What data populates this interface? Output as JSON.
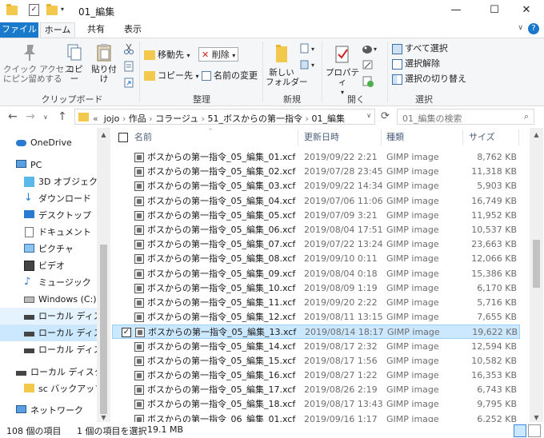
{
  "window": {
    "title": "01_編集",
    "minimize": "—",
    "maximize": "☐",
    "close": "✕"
  },
  "ribbon_tabs": {
    "file": "ファイル",
    "home": "ホーム",
    "share": "共有",
    "view": "表示"
  },
  "ribbon": {
    "clipboard": {
      "pin": "クイック アクセス\nにピン留めする",
      "copy": "コピー",
      "paste": "貼り付け",
      "label": "クリップボード"
    },
    "organize": {
      "move_to": "移動先",
      "copy_to": "コピー先",
      "delete": "削除",
      "rename": "名前の変更",
      "label": "整理"
    },
    "new": {
      "new_folder": "新しい\nフォルダー",
      "label": "新規"
    },
    "open": {
      "properties": "プロパティ",
      "label": "開く"
    },
    "select": {
      "select_all": "すべて選択",
      "select_none": "選択解除",
      "invert": "選択の切り替え",
      "label": "選択"
    }
  },
  "address": {
    "path": [
      "jojo",
      "作品",
      "コラージュ",
      "51_ボスからの第一指令",
      "01_編集"
    ],
    "prefix": "«",
    "search_placeholder": "01_編集の検索"
  },
  "nav_pane": {
    "items": [
      {
        "label": "OneDrive",
        "icon": "cloud-icon"
      },
      {
        "label": "PC",
        "icon": "pc-icon"
      },
      {
        "label": "3D オブジェクト",
        "icon": "cube-icon"
      },
      {
        "label": "ダウンロード",
        "icon": "download-icon"
      },
      {
        "label": "デスクトップ",
        "icon": "desktop-icon"
      },
      {
        "label": "ドキュメント",
        "icon": "document-icon"
      },
      {
        "label": "ピクチャ",
        "icon": "picture-icon"
      },
      {
        "label": "ビデオ",
        "icon": "video-icon"
      },
      {
        "label": "ミュージック",
        "icon": "music-icon"
      },
      {
        "label": "Windows (C:)",
        "icon": "drive-icon"
      },
      {
        "label": "ローカル ディスク (E",
        "icon": "drive-icon"
      },
      {
        "label": "ローカル ディスク (F",
        "icon": "drive-icon"
      },
      {
        "label": "ローカル ディスク (G",
        "icon": "drive-icon"
      },
      {
        "label": "ローカル ディスク (G:)",
        "icon": "drive-icon"
      },
      {
        "label": "sc バックアップ",
        "icon": "folder-icon"
      },
      {
        "label": "ネットワーク",
        "icon": "network-icon"
      }
    ]
  },
  "file_list": {
    "columns": {
      "name": "名前",
      "date": "更新日時",
      "type": "種類",
      "size": "サイズ"
    },
    "rows": [
      {
        "name": "ボスからの第一指令_05_編集_01.xcf",
        "date": "2019/09/22 2:21",
        "type": "GIMP image",
        "size": "8,762 KB"
      },
      {
        "name": "ボスからの第一指令_05_編集_02.xcf",
        "date": "2019/07/28 23:45",
        "type": "GIMP image",
        "size": "11,318 KB"
      },
      {
        "name": "ボスからの第一指令_05_編集_03.xcf",
        "date": "2019/09/22 14:34",
        "type": "GIMP image",
        "size": "5,903 KB"
      },
      {
        "name": "ボスからの第一指令_05_編集_04.xcf",
        "date": "2019/07/06 11:06",
        "type": "GIMP image",
        "size": "16,749 KB"
      },
      {
        "name": "ボスからの第一指令_05_編集_05.xcf",
        "date": "2019/07/09 3:21",
        "type": "GIMP image",
        "size": "11,952 KB"
      },
      {
        "name": "ボスからの第一指令_05_編集_06.xcf",
        "date": "2019/08/04 17:51",
        "type": "GIMP image",
        "size": "10,537 KB"
      },
      {
        "name": "ボスからの第一指令_05_編集_07.xcf",
        "date": "2019/07/22 13:24",
        "type": "GIMP image",
        "size": "23,663 KB"
      },
      {
        "name": "ボスからの第一指令_05_編集_08.xcf",
        "date": "2019/09/10 0:11",
        "type": "GIMP image",
        "size": "12,066 KB"
      },
      {
        "name": "ボスからの第一指令_05_編集_09.xcf",
        "date": "2019/08/04 0:18",
        "type": "GIMP image",
        "size": "15,386 KB"
      },
      {
        "name": "ボスからの第一指令_05_編集_10.xcf",
        "date": "2019/08/09 1:19",
        "type": "GIMP image",
        "size": "6,170 KB"
      },
      {
        "name": "ボスからの第一指令_05_編集_11.xcf",
        "date": "2019/09/20 2:22",
        "type": "GIMP image",
        "size": "5,716 KB"
      },
      {
        "name": "ボスからの第一指令_05_編集_12.xcf",
        "date": "2019/08/11 13:15",
        "type": "GIMP image",
        "size": "7,655 KB"
      },
      {
        "name": "ボスからの第一指令_05_編集_13.xcf",
        "date": "2019/08/14 18:17",
        "type": "GIMP image",
        "size": "19,622 KB",
        "selected": true
      },
      {
        "name": "ボスからの第一指令_05_編集_14.xcf",
        "date": "2019/08/17 2:32",
        "type": "GIMP image",
        "size": "12,594 KB"
      },
      {
        "name": "ボスからの第一指令_05_編集_15.xcf",
        "date": "2019/08/17 1:56",
        "type": "GIMP image",
        "size": "10,582 KB"
      },
      {
        "name": "ボスからの第一指令_05_編集_16.xcf",
        "date": "2019/08/27 1:22",
        "type": "GIMP image",
        "size": "16,353 KB"
      },
      {
        "name": "ボスからの第一指令_05_編集_17.xcf",
        "date": "2019/08/26 2:19",
        "type": "GIMP image",
        "size": "6,743 KB"
      },
      {
        "name": "ボスからの第一指令_05_編集_18.xcf",
        "date": "2019/08/17 13:43",
        "type": "GIMP image",
        "size": "9,795 KB"
      },
      {
        "name": "ボスからの第一指令_06_編集_01.xcf",
        "date": "2019/09/16 1:17",
        "type": "GIMP image",
        "size": "6,252 KB"
      }
    ]
  },
  "status_bar": {
    "item_count": "108 個の項目",
    "selection": "1 個の項目を選択",
    "selection_size": "19.1 MB"
  },
  "colors": {
    "accent": "#1979ca",
    "selection_bg": "#cce8ff",
    "selection_border": "#99d1ff",
    "header_text": "#4c607a"
  }
}
